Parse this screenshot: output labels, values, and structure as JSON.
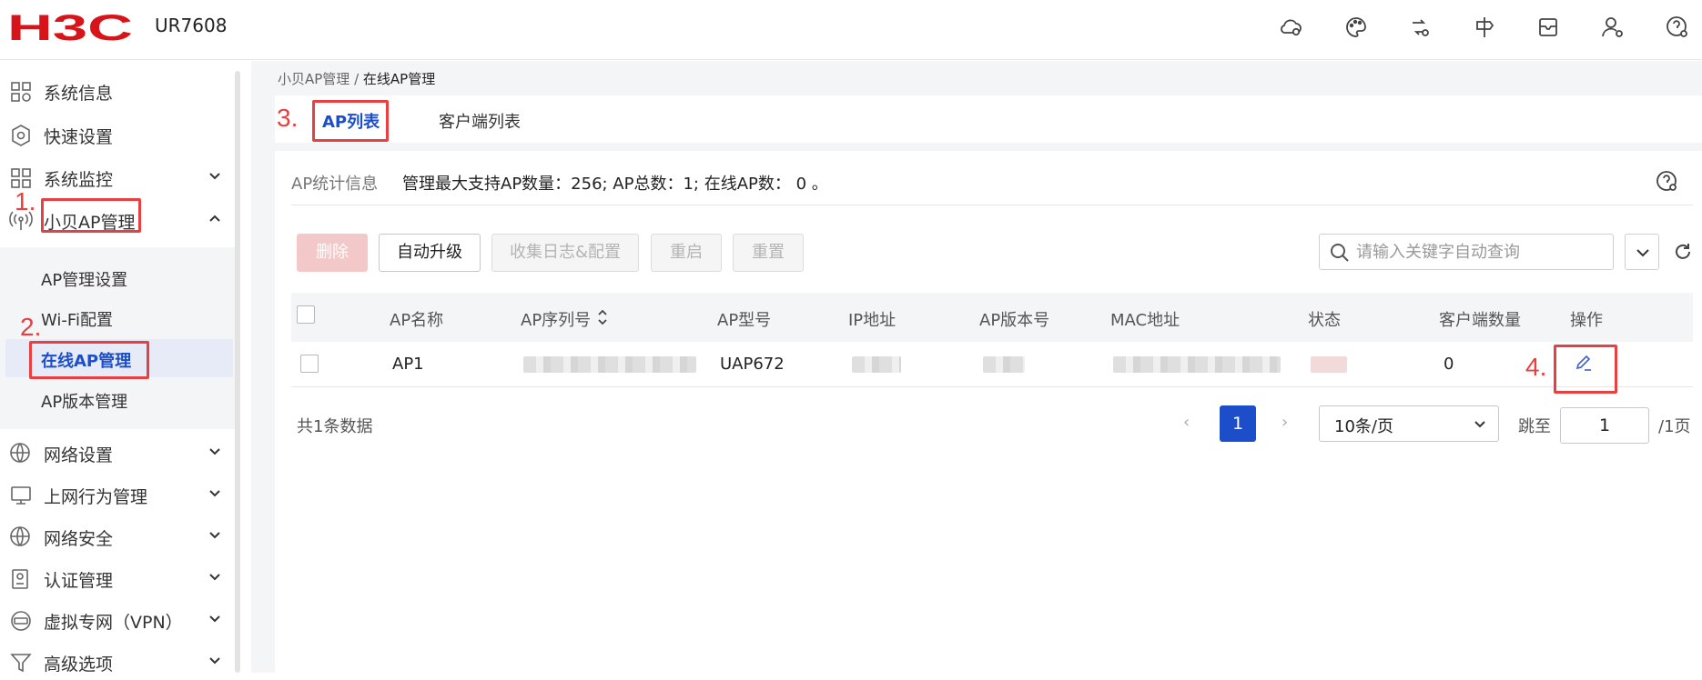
{
  "header": {
    "brand": "H3C",
    "model": "UR7608",
    "icons": [
      "cloud-gear-icon",
      "palette-icon",
      "sync-icon",
      "signpost-icon",
      "mailbox-icon",
      "user-gear-icon",
      "help-gear-icon"
    ]
  },
  "sidebar": {
    "items": [
      {
        "label": "系统信息",
        "icon": "system-info-icon"
      },
      {
        "label": "快速设置",
        "icon": "quick-setup-icon"
      },
      {
        "label": "系统监控",
        "icon": "monitor-icon"
      },
      {
        "label": "小贝AP管理",
        "icon": "wireless-icon"
      },
      {
        "label": "网络设置",
        "icon": "globe-gear-icon"
      },
      {
        "label": "上网行为管理",
        "icon": "behavior-icon"
      },
      {
        "label": "网络安全",
        "icon": "globe-shield-icon"
      },
      {
        "label": "认证管理",
        "icon": "auth-icon"
      },
      {
        "label": "虚拟专网（VPN）",
        "icon": "vpn-icon"
      },
      {
        "label": "高级选项",
        "icon": "filter-icon"
      }
    ],
    "submenu": [
      "AP管理设置",
      "Wi-Fi配置",
      "在线AP管理",
      "AP版本管理"
    ]
  },
  "annotations": [
    "1.",
    "2.",
    "3.",
    "4."
  ],
  "breadcrumb": {
    "parent": "小贝AP管理 /",
    "current": "在线AP管理"
  },
  "tabs": [
    "AP列表",
    "客户端列表"
  ],
  "stats": {
    "label": "AP统计信息",
    "text": "管理最大支持AP数量：256; AP总数：1; 在线AP数：  0 。"
  },
  "toolbar": {
    "delete": "删除",
    "auto_upgrade": "自动升级",
    "collect": "收集日志&配置",
    "restart": "重启",
    "reset": "重置",
    "search_placeholder": "请输入关键字自动查询"
  },
  "table": {
    "columns": [
      "AP名称",
      "AP序列号",
      "AP型号",
      "IP地址",
      "AP版本号",
      "MAC地址",
      "状态",
      "客户端数量",
      "操作"
    ],
    "rows": [
      {
        "name": "AP1",
        "model": "UAP672",
        "clients": "0"
      }
    ]
  },
  "pagination": {
    "total_text": "共1条数据",
    "current": "1",
    "page_size": "10条/页",
    "jump_label": "跳至",
    "jump_value": "1",
    "total_pages": "/1页"
  },
  "colors": {
    "accent": "#1d4ec9",
    "annotation": "#e84040"
  }
}
